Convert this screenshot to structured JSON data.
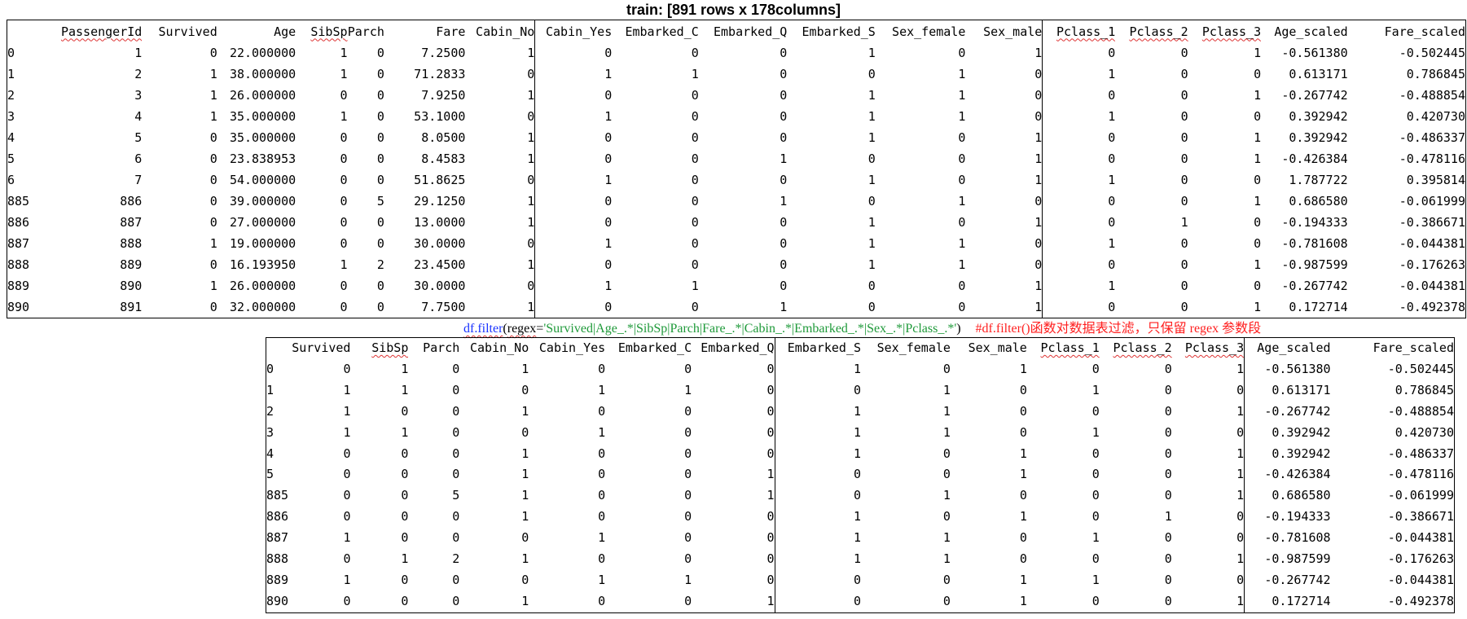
{
  "title": "train:  [891 rows x 178columns]",
  "table1": {
    "headers": [
      "",
      "PassengerId",
      "Survived",
      "Age",
      "SibSp",
      "Parch",
      "Fare",
      "Cabin_No",
      "Cabin_Yes",
      "Embarked_C",
      "Embarked_Q",
      "Embarked_S",
      "Sex_female",
      "Sex_male",
      "Pclass_1",
      "Pclass_2",
      "Pclass_3",
      "Age_scaled",
      "Fare_scaled"
    ],
    "rows": [
      [
        "0",
        "1",
        "0",
        "22.000000",
        "1",
        "0",
        "7.2500",
        "1",
        "0",
        "0",
        "0",
        "1",
        "0",
        "1",
        "0",
        "0",
        "1",
        "-0.561380",
        "-0.502445"
      ],
      [
        "1",
        "2",
        "1",
        "38.000000",
        "1",
        "0",
        "71.2833",
        "0",
        "1",
        "1",
        "0",
        "0",
        "1",
        "0",
        "1",
        "0",
        "0",
        "0.613171",
        "0.786845"
      ],
      [
        "2",
        "3",
        "1",
        "26.000000",
        "0",
        "0",
        "7.9250",
        "1",
        "0",
        "0",
        "0",
        "1",
        "1",
        "0",
        "0",
        "0",
        "1",
        "-0.267742",
        "-0.488854"
      ],
      [
        "3",
        "4",
        "1",
        "35.000000",
        "1",
        "0",
        "53.1000",
        "0",
        "1",
        "0",
        "0",
        "1",
        "1",
        "0",
        "1",
        "0",
        "0",
        "0.392942",
        "0.420730"
      ],
      [
        "4",
        "5",
        "0",
        "35.000000",
        "0",
        "0",
        "8.0500",
        "1",
        "0",
        "0",
        "0",
        "1",
        "0",
        "1",
        "0",
        "0",
        "1",
        "0.392942",
        "-0.486337"
      ],
      [
        "5",
        "6",
        "0",
        "23.838953",
        "0",
        "0",
        "8.4583",
        "1",
        "0",
        "0",
        "1",
        "0",
        "0",
        "1",
        "0",
        "0",
        "1",
        "-0.426384",
        "-0.478116"
      ],
      [
        "6",
        "7",
        "0",
        "54.000000",
        "0",
        "0",
        "51.8625",
        "0",
        "1",
        "0",
        "0",
        "1",
        "0",
        "1",
        "1",
        "0",
        "0",
        "1.787722",
        "0.395814"
      ],
      [
        "885",
        "886",
        "0",
        "39.000000",
        "0",
        "5",
        "29.1250",
        "1",
        "0",
        "0",
        "1",
        "0",
        "1",
        "0",
        "0",
        "0",
        "1",
        "0.686580",
        "-0.061999"
      ],
      [
        "886",
        "887",
        "0",
        "27.000000",
        "0",
        "0",
        "13.0000",
        "1",
        "0",
        "0",
        "0",
        "1",
        "0",
        "1",
        "0",
        "1",
        "0",
        "-0.194333",
        "-0.386671"
      ],
      [
        "887",
        "888",
        "1",
        "19.000000",
        "0",
        "0",
        "30.0000",
        "0",
        "1",
        "0",
        "0",
        "1",
        "1",
        "0",
        "1",
        "0",
        "0",
        "-0.781608",
        "-0.044381"
      ],
      [
        "888",
        "889",
        "0",
        "16.193950",
        "1",
        "2",
        "23.4500",
        "1",
        "0",
        "0",
        "0",
        "1",
        "1",
        "0",
        "0",
        "0",
        "1",
        "-0.987599",
        "-0.176263"
      ],
      [
        "889",
        "890",
        "1",
        "26.000000",
        "0",
        "0",
        "30.0000",
        "0",
        "1",
        "1",
        "0",
        "0",
        "0",
        "1",
        "1",
        "0",
        "0",
        "-0.267742",
        "-0.044381"
      ],
      [
        "890",
        "891",
        "0",
        "32.000000",
        "0",
        "0",
        "7.7500",
        "1",
        "0",
        "0",
        "1",
        "0",
        "0",
        "1",
        "0",
        "0",
        "1",
        "0.172714",
        "-0.492378"
      ]
    ]
  },
  "code_line": {
    "call": "df.filter",
    "open": "(",
    "kw": "regex",
    "eq": "=",
    "regex_str": "'Survived|Age_.*|SibSp|Parch|Fare_.*|Cabin_.*|Embarked_.*|Sex_.*|Pclass_.*'",
    "close": ")",
    "comment": "#df.filter()函数对数据表过滤，只保留 regex 参数段"
  },
  "table2": {
    "headers": [
      "",
      "Survived",
      "SibSp",
      "Parch",
      "Cabin_No",
      "Cabin_Yes",
      "Embarked_C",
      "Embarked_Q",
      "Embarked_S",
      "Sex_female",
      "Sex_male",
      "Pclass_1",
      "Pclass_2",
      "Pclass_3",
      "Age_scaled",
      "Fare_scaled"
    ],
    "rows": [
      [
        "0",
        "0",
        "1",
        "0",
        "1",
        "0",
        "0",
        "0",
        "1",
        "0",
        "1",
        "0",
        "0",
        "1",
        "-0.561380",
        "-0.502445"
      ],
      [
        "1",
        "1",
        "1",
        "0",
        "0",
        "1",
        "1",
        "0",
        "0",
        "1",
        "0",
        "1",
        "0",
        "0",
        "0.613171",
        "0.786845"
      ],
      [
        "2",
        "1",
        "0",
        "0",
        "1",
        "0",
        "0",
        "0",
        "1",
        "1",
        "0",
        "0",
        "0",
        "1",
        "-0.267742",
        "-0.488854"
      ],
      [
        "3",
        "1",
        "1",
        "0",
        "0",
        "1",
        "0",
        "0",
        "1",
        "1",
        "0",
        "1",
        "0",
        "0",
        "0.392942",
        "0.420730"
      ],
      [
        "4",
        "0",
        "0",
        "0",
        "1",
        "0",
        "0",
        "0",
        "1",
        "0",
        "1",
        "0",
        "0",
        "1",
        "0.392942",
        "-0.486337"
      ],
      [
        "5",
        "0",
        "0",
        "0",
        "1",
        "0",
        "0",
        "1",
        "0",
        "0",
        "1",
        "0",
        "0",
        "1",
        "-0.426384",
        "-0.478116"
      ],
      [
        "885",
        "0",
        "0",
        "5",
        "1",
        "0",
        "0",
        "1",
        "0",
        "1",
        "0",
        "0",
        "0",
        "1",
        "0.686580",
        "-0.061999"
      ],
      [
        "886",
        "0",
        "0",
        "0",
        "1",
        "0",
        "0",
        "0",
        "1",
        "0",
        "1",
        "0",
        "1",
        "0",
        "-0.194333",
        "-0.386671"
      ],
      [
        "887",
        "1",
        "0",
        "0",
        "0",
        "1",
        "0",
        "0",
        "1",
        "1",
        "0",
        "1",
        "0",
        "0",
        "-0.781608",
        "-0.044381"
      ],
      [
        "888",
        "0",
        "1",
        "2",
        "1",
        "0",
        "0",
        "0",
        "1",
        "1",
        "0",
        "0",
        "0",
        "1",
        "-0.987599",
        "-0.176263"
      ],
      [
        "889",
        "1",
        "0",
        "0",
        "0",
        "1",
        "1",
        "0",
        "0",
        "0",
        "1",
        "1",
        "0",
        "0",
        "-0.267742",
        "-0.044381"
      ],
      [
        "890",
        "0",
        "0",
        "0",
        "1",
        "0",
        "0",
        "1",
        "0",
        "0",
        "1",
        "0",
        "0",
        "1",
        "0.172714",
        "-0.492378"
      ]
    ]
  }
}
